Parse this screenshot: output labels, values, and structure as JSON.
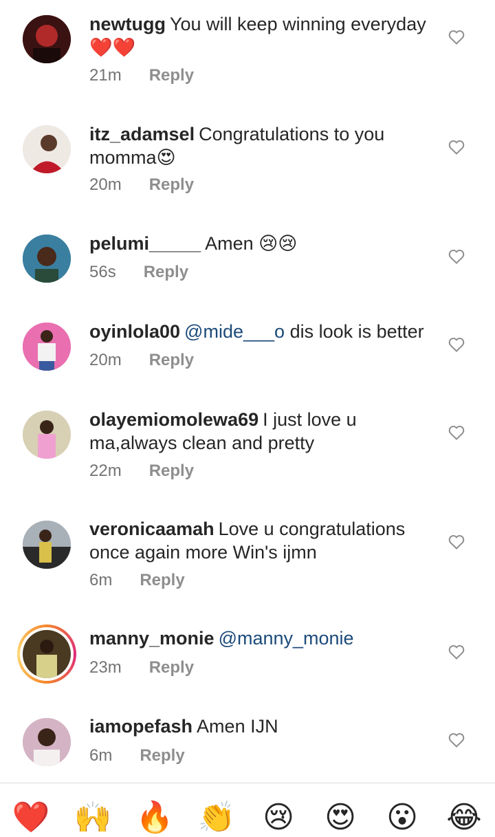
{
  "comments": [
    {
      "username": "newtugg",
      "text": "You will keep winning everyday ❤️❤️",
      "time": "21m",
      "reply": "Reply"
    },
    {
      "username": "itz_adamsel",
      "text": "Congratulations to you momma😍",
      "time": "20m",
      "reply": "Reply"
    },
    {
      "username": "pelumi_____",
      "text": "Amen 😢😢",
      "time": "56s",
      "reply": "Reply"
    },
    {
      "username": "oyinlola00",
      "mention": "@mide___o",
      "text": "dis look is better",
      "time": "20m",
      "reply": "Reply"
    },
    {
      "username": "olayemiomolewa69",
      "text": "I just love  u ma,always clean and pretty",
      "time": "22m",
      "reply": "Reply"
    },
    {
      "username": "veronicaamah",
      "text": "Love u congratulations once again more Win's ijmn",
      "time": "6m",
      "reply": "Reply"
    },
    {
      "username": "manny_monie",
      "mention": "@manny_monie",
      "text": "",
      "time": "23m",
      "reply": "Reply"
    },
    {
      "username": "iamopefash",
      "text": "Amen IJN",
      "time": "6m",
      "reply": "Reply"
    }
  ],
  "emoji_bar": [
    "❤️",
    "🙌",
    "🔥",
    "👏",
    "😢",
    "😍",
    "😮",
    "😂"
  ],
  "colors": {
    "mention": "#1b4a7a",
    "meta": "#737373",
    "heart_icon": "#8e8e8e"
  }
}
